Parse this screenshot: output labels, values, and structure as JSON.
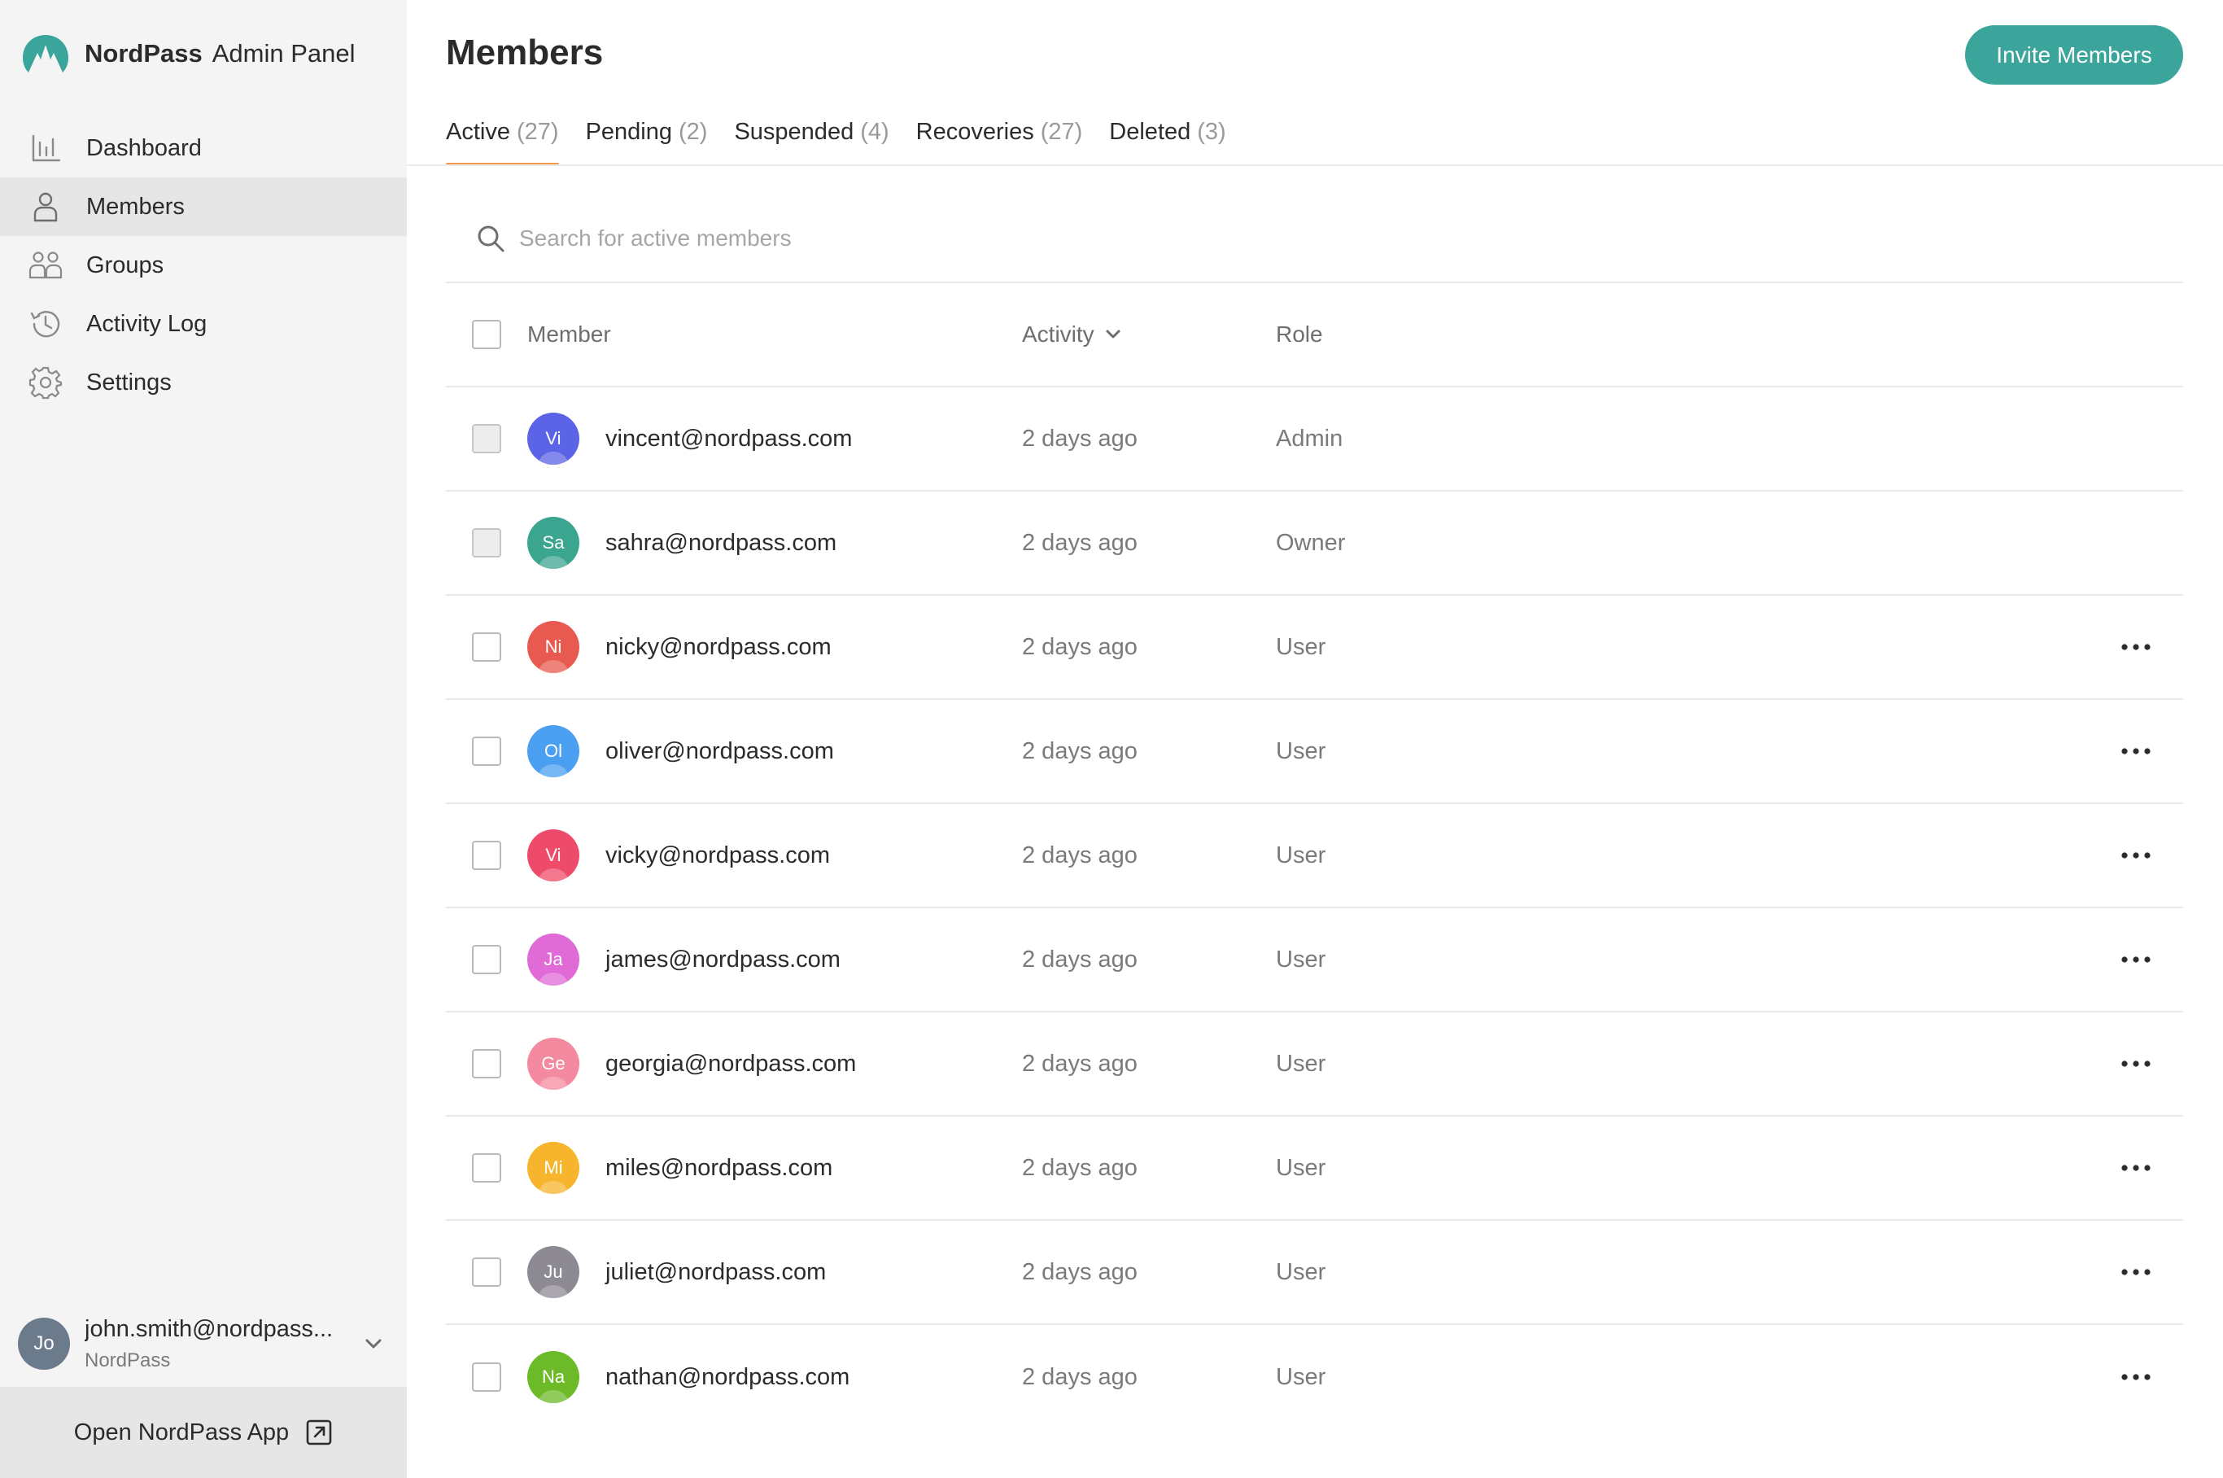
{
  "brand": {
    "name": "NordPass",
    "subtitle": "Admin Panel",
    "color": "#3ba59c"
  },
  "nav": {
    "items": [
      {
        "label": "Dashboard",
        "icon": "bar-chart-icon"
      },
      {
        "label": "Members",
        "icon": "person-icon",
        "active": true
      },
      {
        "label": "Groups",
        "icon": "group-icon"
      },
      {
        "label": "Activity Log",
        "icon": "history-icon"
      },
      {
        "label": "Settings",
        "icon": "gear-icon"
      }
    ]
  },
  "user": {
    "initials": "Jo",
    "email": "john.smith@nordpass...",
    "org": "NordPass"
  },
  "open_app": {
    "label": "Open NordPass App",
    "icon": "external-link-icon"
  },
  "page": {
    "title": "Members",
    "invite_label": "Invite Members"
  },
  "tabs": [
    {
      "label": "Active",
      "count": "(27)",
      "active": true
    },
    {
      "label": "Pending",
      "count": "(2)"
    },
    {
      "label": "Suspended",
      "count": "(4)"
    },
    {
      "label": "Recoveries",
      "count": "(27)"
    },
    {
      "label": "Deleted",
      "count": "(3)"
    }
  ],
  "search": {
    "placeholder": "Search for active members",
    "value": ""
  },
  "table": {
    "headers": {
      "member": "Member",
      "activity": "Activity",
      "role": "Role"
    },
    "rows": [
      {
        "initials": "Vi",
        "email": "vincent@nordpass.com",
        "activity": "2 days ago",
        "role": "Admin",
        "color": "#5b63e6",
        "locked": true
      },
      {
        "initials": "Sa",
        "email": "sahra@nordpass.com",
        "activity": "2 days ago",
        "role": "Owner",
        "color": "#3ba58f",
        "locked": true
      },
      {
        "initials": "Ni",
        "email": "nicky@nordpass.com",
        "activity": "2 days ago",
        "role": "User",
        "color": "#e85a4f",
        "locked": false
      },
      {
        "initials": "Ol",
        "email": "oliver@nordpass.com",
        "activity": "2 days ago",
        "role": "User",
        "color": "#4a9ff0",
        "locked": false
      },
      {
        "initials": "Vi",
        "email": "vicky@nordpass.com",
        "activity": "2 days ago",
        "role": "User",
        "color": "#ee4a6a",
        "locked": false
      },
      {
        "initials": "Ja",
        "email": "james@nordpass.com",
        "activity": "2 days ago",
        "role": "User",
        "color": "#e06ad6",
        "locked": false
      },
      {
        "initials": "Ge",
        "email": "georgia@nordpass.com",
        "activity": "2 days ago",
        "role": "User",
        "color": "#f48aa0",
        "locked": false
      },
      {
        "initials": "Mi",
        "email": "miles@nordpass.com",
        "activity": "2 days ago",
        "role": "User",
        "color": "#f6b52c",
        "locked": false
      },
      {
        "initials": "Ju",
        "email": "juliet@nordpass.com",
        "activity": "2 days ago",
        "role": "User",
        "color": "#8e8a93",
        "locked": false
      },
      {
        "initials": "Na",
        "email": "nathan@nordpass.com",
        "activity": "2 days ago",
        "role": "User",
        "color": "#6cba28",
        "locked": false
      }
    ]
  }
}
